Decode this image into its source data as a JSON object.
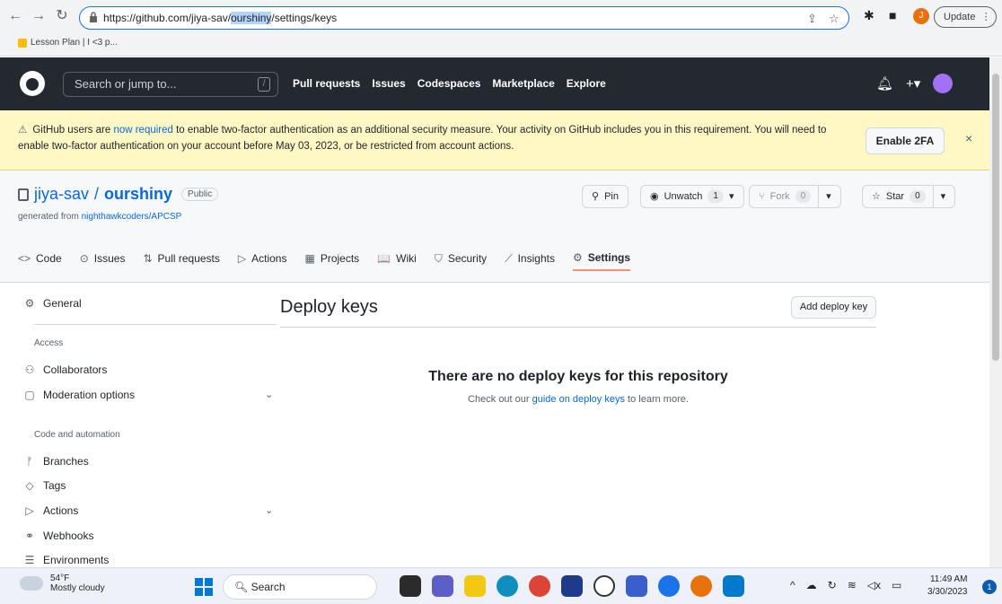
{
  "browser": {
    "url_prefix": "https://github.com/jiya-sav/",
    "url_selected": "ourshiny",
    "url_suffix": "/settings/keys",
    "bookmark": "Lesson Plan | I <3 p...",
    "update_label": "Update",
    "profile_initial": "J"
  },
  "header": {
    "search_placeholder": "Search or jump to...",
    "search_shortcut": "/",
    "nav": [
      "Pull requests",
      "Issues",
      "Codespaces",
      "Marketplace",
      "Explore"
    ]
  },
  "banner": {
    "text_before_link": "GitHub users are ",
    "link": "now required",
    "text_after_link": " to enable two-factor authentication as an additional security measure. Your activity on GitHub includes you in this requirement. You will need to enable two-factor authentication on your account before May 03, 2023, or be restricted from account actions.",
    "button": "Enable 2FA",
    "close": "×"
  },
  "repo": {
    "owner": "jiya-sav",
    "separator": "/",
    "name": "ourshiny",
    "visibility": "Public",
    "generated_prefix": "generated from ",
    "generated_link": "nighthawkcoders/APCSP",
    "pin": "Pin",
    "unwatch": "Unwatch",
    "watch_count": "1",
    "fork": "Fork",
    "fork_count": "0",
    "star": "Star",
    "star_count": "0"
  },
  "tabs": [
    {
      "label": "Code",
      "icon": "<>"
    },
    {
      "label": "Issues",
      "icon": "⊙"
    },
    {
      "label": "Pull requests",
      "icon": "⇅"
    },
    {
      "label": "Actions",
      "icon": "▷"
    },
    {
      "label": "Projects",
      "icon": "▦"
    },
    {
      "label": "Wiki",
      "icon": "📖"
    },
    {
      "label": "Security",
      "icon": "⛉"
    },
    {
      "label": "Insights",
      "icon": "⟋"
    },
    {
      "label": "Settings",
      "icon": "⚙"
    }
  ],
  "sidebar": {
    "general": "General",
    "access_heading": "Access",
    "collaborators": "Collaborators",
    "moderation": "Moderation options",
    "code_heading": "Code and automation",
    "branches": "Branches",
    "tags": "Tags",
    "actions": "Actions",
    "webhooks": "Webhooks",
    "environments": "Environments"
  },
  "main": {
    "title": "Deploy keys",
    "add_button": "Add deploy key",
    "empty_title": "There are no deploy keys for this repository",
    "empty_prefix": "Check out our ",
    "empty_link": "guide on deploy keys",
    "empty_suffix": " to learn more."
  },
  "taskbar": {
    "temp": "54°F",
    "weather": "Mostly cloudy",
    "search": "Search",
    "time": "11:49 AM",
    "date": "3/30/2023",
    "notifications": "1"
  }
}
